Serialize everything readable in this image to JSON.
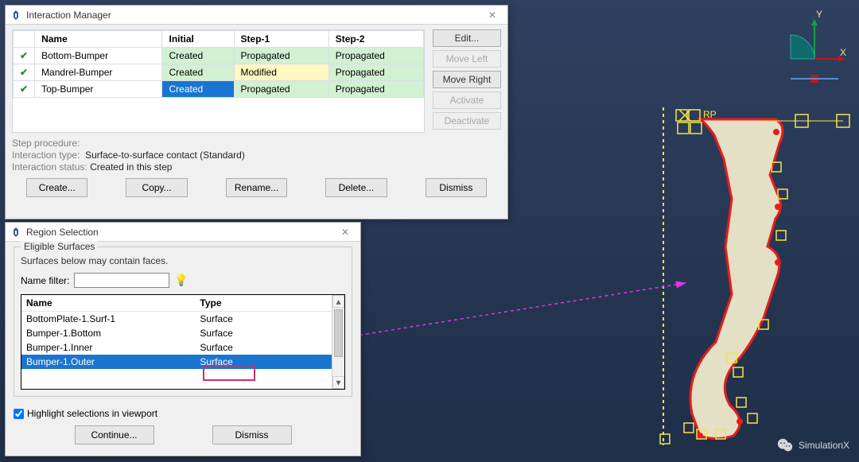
{
  "interaction_manager": {
    "title": "Interaction Manager",
    "columns": {
      "c0": "",
      "c1": "Name",
      "c2": "Initial",
      "c3": "Step-1",
      "c4": "Step-2"
    },
    "rows": [
      {
        "name": "Bottom-Bumper",
        "initial": "Created",
        "step1": "Propagated",
        "step2": "Propagated"
      },
      {
        "name": "Mandrel-Bumper",
        "initial": "Created",
        "step1": "Modified",
        "step2": "Propagated"
      },
      {
        "name": "Top-Bumper",
        "initial": "Created",
        "step1": "Propagated",
        "step2": "Propagated"
      }
    ],
    "side_buttons": {
      "edit": "Edit...",
      "move_left": "Move Left",
      "move_right": "Move Right",
      "activate": "Activate",
      "deactivate": "Deactivate"
    },
    "meta": {
      "proc_label": "Step procedure:",
      "type_label": "Interaction type:",
      "type_value": "Surface-to-surface contact (Standard)",
      "status_label": "Interaction status:",
      "status_value": "Created in this step"
    },
    "bottom_buttons": {
      "create": "Create...",
      "copy": "Copy...",
      "rename": "Rename...",
      "delete": "Delete...",
      "dismiss": "Dismiss"
    }
  },
  "region_selection": {
    "title": "Region Selection",
    "group_title": "Eligible Surfaces",
    "note": "Surfaces below may contain faces.",
    "filter_label": "Name filter:",
    "filter_value": "",
    "columns": {
      "name": "Name",
      "type": "Type"
    },
    "rows": [
      {
        "name": "BottomPlate-1.Surf-1",
        "type": "Surface"
      },
      {
        "name": "Bumper-1.Bottom",
        "type": "Surface"
      },
      {
        "name": "Bumper-1.Inner",
        "type": "Surface"
      },
      {
        "name": "Bumper-1.Outer",
        "type": "Surface"
      }
    ],
    "highlight_label": "Highlight selections in viewport",
    "highlight_checked": true,
    "buttons": {
      "continue": "Continue...",
      "dismiss": "Dismiss"
    }
  },
  "viewport": {
    "axis_y": "Y",
    "axis_x": "X",
    "rp_label": "RP"
  },
  "watermark": "SimulationX",
  "close_glyph": "✕"
}
